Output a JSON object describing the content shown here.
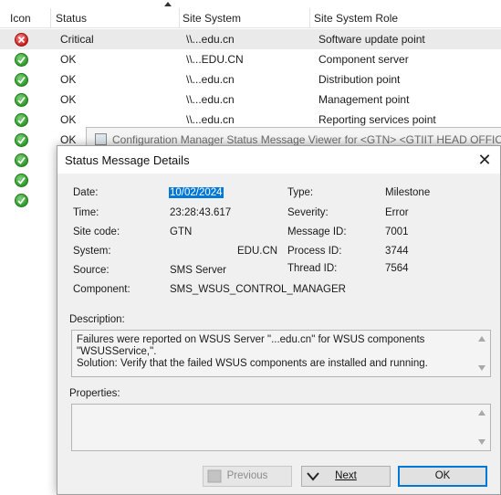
{
  "list": {
    "columns": [
      "Icon",
      "Status",
      "Site System",
      "Site System Role"
    ],
    "rows": [
      {
        "status": "Critical",
        "status_type": "error",
        "site_system": "\\\\...edu.cn",
        "role": "Software update point"
      },
      {
        "status": "OK",
        "status_type": "ok",
        "site_system": "\\\\...EDU.CN",
        "role": "Component server"
      },
      {
        "status": "OK",
        "status_type": "ok",
        "site_system": "\\\\...edu.cn",
        "role": "Distribution point"
      },
      {
        "status": "OK",
        "status_type": "ok",
        "site_system": "\\\\...edu.cn",
        "role": "Management point"
      },
      {
        "status": "OK",
        "status_type": "ok",
        "site_system": "\\\\...edu.cn",
        "role": "Reporting services point"
      },
      {
        "status": "OK",
        "status_type": "ok",
        "site_system": "",
        "role": ""
      },
      {
        "status": "",
        "status_type": "ok",
        "site_system": "",
        "role": ""
      },
      {
        "status": "",
        "status_type": "ok",
        "site_system": "",
        "role": ""
      },
      {
        "status": "",
        "status_type": "ok",
        "site_system": "",
        "role": ""
      }
    ]
  },
  "viewer": {
    "title": "Configuration Manager Status Message Viewer for <GTN> <GTIIT HEAD OFFICE>"
  },
  "dialog": {
    "title": "Status Message Details",
    "close_glyph": "✕",
    "labels": {
      "date": "Date:",
      "time": "Time:",
      "site_code": "Site code:",
      "system": "System:",
      "source": "Source:",
      "component": "Component:",
      "type": "Type:",
      "severity": "Severity:",
      "message_id": "Message ID:",
      "process_id": "Process ID:",
      "thread_id": "Thread ID:",
      "description": "Description:",
      "properties": "Properties:"
    },
    "values": {
      "date": "10/02/2024",
      "time": "23:28:43.617",
      "site_code": "GTN",
      "system": "EDU.CN",
      "source": "SMS Server",
      "component": "SMS_WSUS_CONTROL_MANAGER",
      "type": "Milestone",
      "severity": "Error",
      "message_id": "7001",
      "process_id": "3744",
      "thread_id": "7564"
    },
    "description_text": "Failures were reported on WSUS Server \"...edu.cn\" for WSUS components \"WSUSService,\".\nSolution: Verify that the failed WSUS components are installed and running.",
    "properties_text": "",
    "buttons": {
      "previous": "Previous",
      "next": "Next",
      "ok": "OK"
    }
  },
  "colors": {
    "selection": "#0078d7",
    "ok_status": "#2f9a2a",
    "error_status": "#cc1f1f"
  }
}
